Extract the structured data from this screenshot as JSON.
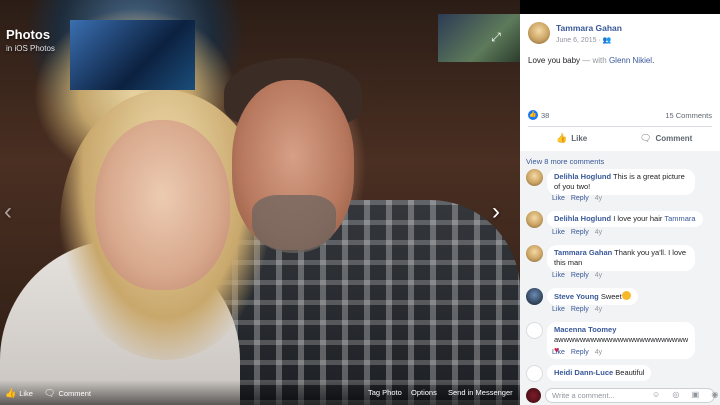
{
  "viewer": {
    "title": "Photos",
    "subtitle": "in iOS Photos",
    "expand_icon": "⤢",
    "prev_icon": "‹",
    "next_icon": "›",
    "bottom": {
      "like_label": "Like",
      "comment_label": "Comment",
      "tag_label": "Tag Photo",
      "options_label": "Options",
      "messenger_label": "Send in Messenger"
    }
  },
  "post": {
    "author": "Tammara Gahan",
    "date": "June 6, 2015 · ",
    "audience_icon": "👥",
    "caption_text": "Love you baby",
    "caption_with": " — with ",
    "caption_tag": "Glenn Nikiel",
    "caption_end": ".",
    "like_count": "38",
    "comments_count": "15 Comments",
    "like_label": "Like",
    "comment_label": "Comment",
    "view_more": "View 8 more comments"
  },
  "comments": [
    {
      "name": "Delihla Hoglund",
      "text": "This is a great picture of you two!",
      "age": "4y"
    },
    {
      "name": "Delihla Hoglund",
      "text": "I love your hair ",
      "tag": "Tammara",
      "age": "4y"
    },
    {
      "name": "Tammara Gahan",
      "text": "Thank you ya'll. I love this man",
      "age": "4y"
    },
    {
      "name": "Steve Young",
      "text": "Sweet",
      "age": "4y"
    },
    {
      "name": "Macenna Toomey",
      "text": "awwwwwwwwwwwwwwwwwwwwwwww",
      "age": "4y"
    },
    {
      "name": "Heidi Dann-Luce",
      "text": "Beautiful",
      "age": ""
    }
  ],
  "comment_actions": {
    "like": "Like",
    "reply": "Reply"
  },
  "composer": {
    "placeholder": "Write a comment...",
    "icons": "☺ ◎ ▣ ◉"
  },
  "colors": {
    "link": "#385898",
    "like_blue": "#1877f2",
    "heart": "#e41e3f"
  }
}
